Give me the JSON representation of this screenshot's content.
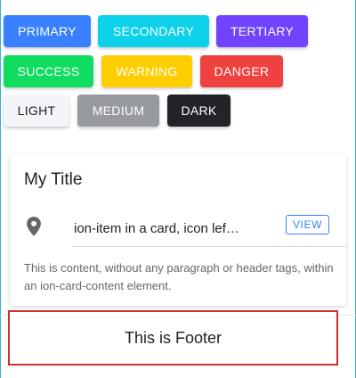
{
  "buttons": {
    "primary": "PRIMARY",
    "secondary": "SECONDARY",
    "tertiary": "TERTIARY",
    "success": "SUCCESS",
    "warning": "WARNING",
    "danger": "DANGER",
    "light": "LIGHT",
    "medium": "MEDIUM",
    "dark": "DARK"
  },
  "colors": {
    "primary": "#3880ff",
    "secondary": "#0cd1e8",
    "tertiary": "#7044ff",
    "success": "#10dc60",
    "warning": "#ffce00",
    "danger": "#f04141",
    "light": "#f4f5f8",
    "medium": "#989aa2",
    "dark": "#222428",
    "footer_border": "#d62c2c"
  },
  "card": {
    "title": "My Title",
    "item": {
      "icon": "pin-icon",
      "text": "ion-item in a card, icon lef…",
      "action_label": "VIEW"
    },
    "content": "This is content, without any paragraph or header tags, within an ion-card-content element."
  },
  "footer": {
    "text": "This is Footer"
  }
}
